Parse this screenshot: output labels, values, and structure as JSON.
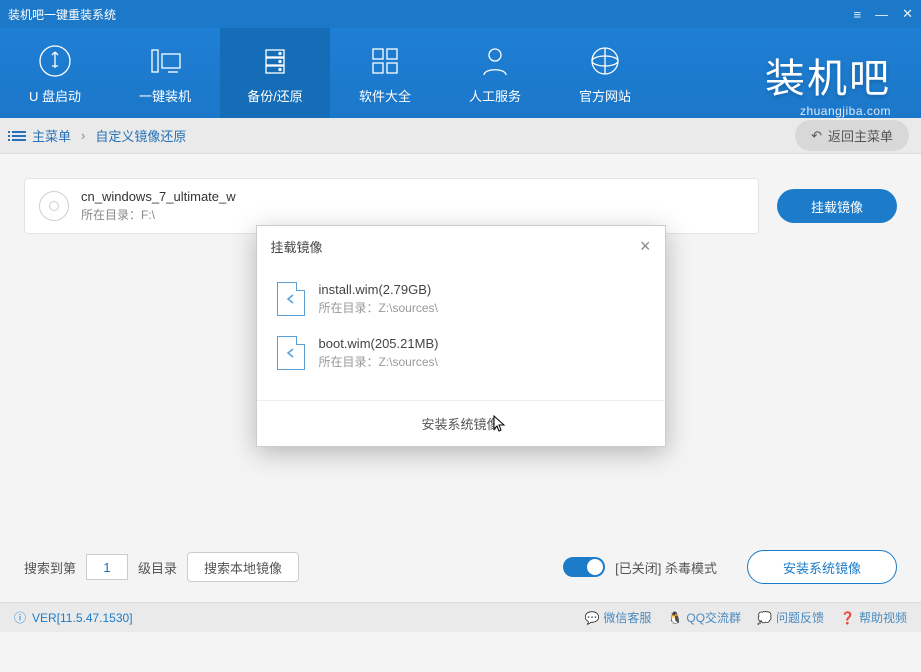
{
  "titlebar": {
    "title": "装机吧一键重装系统"
  },
  "nav": {
    "items": [
      {
        "label": "U 盘启动"
      },
      {
        "label": "一键装机"
      },
      {
        "label": "备份/还原"
      },
      {
        "label": "软件大全"
      },
      {
        "label": "人工服务"
      },
      {
        "label": "官方网站"
      }
    ],
    "brand": "装机吧",
    "brand_url": "zhuangjiba.com"
  },
  "breadcrumb": {
    "root": "主菜单",
    "current": "自定义镜像还原",
    "return_label": "返回主菜单"
  },
  "iso": {
    "name": "cn_windows_7_ultimate_w",
    "path_label": "所在目录：F:\\",
    "mount_button": "挂载镜像"
  },
  "bottom": {
    "search_prefix": "搜索到第",
    "level_value": "1",
    "search_suffix": "级目录",
    "search_btn": "搜索本地镜像",
    "antivirus_label": "[已关闭] 杀毒模式",
    "install_btn": "安装系统镜像"
  },
  "status": {
    "version": "VER[11.5.47.1530]",
    "links": [
      "微信客服",
      "QQ交流群",
      "问题反馈",
      "帮助视频"
    ]
  },
  "modal": {
    "title": "挂载镜像",
    "items": [
      {
        "name": "install.wim(2.79GB)",
        "path": "所在目录：Z:\\sources\\"
      },
      {
        "name": "boot.wim(205.21MB)",
        "path": "所在目录：Z:\\sources\\"
      }
    ],
    "footer": "安装系统镜像"
  }
}
